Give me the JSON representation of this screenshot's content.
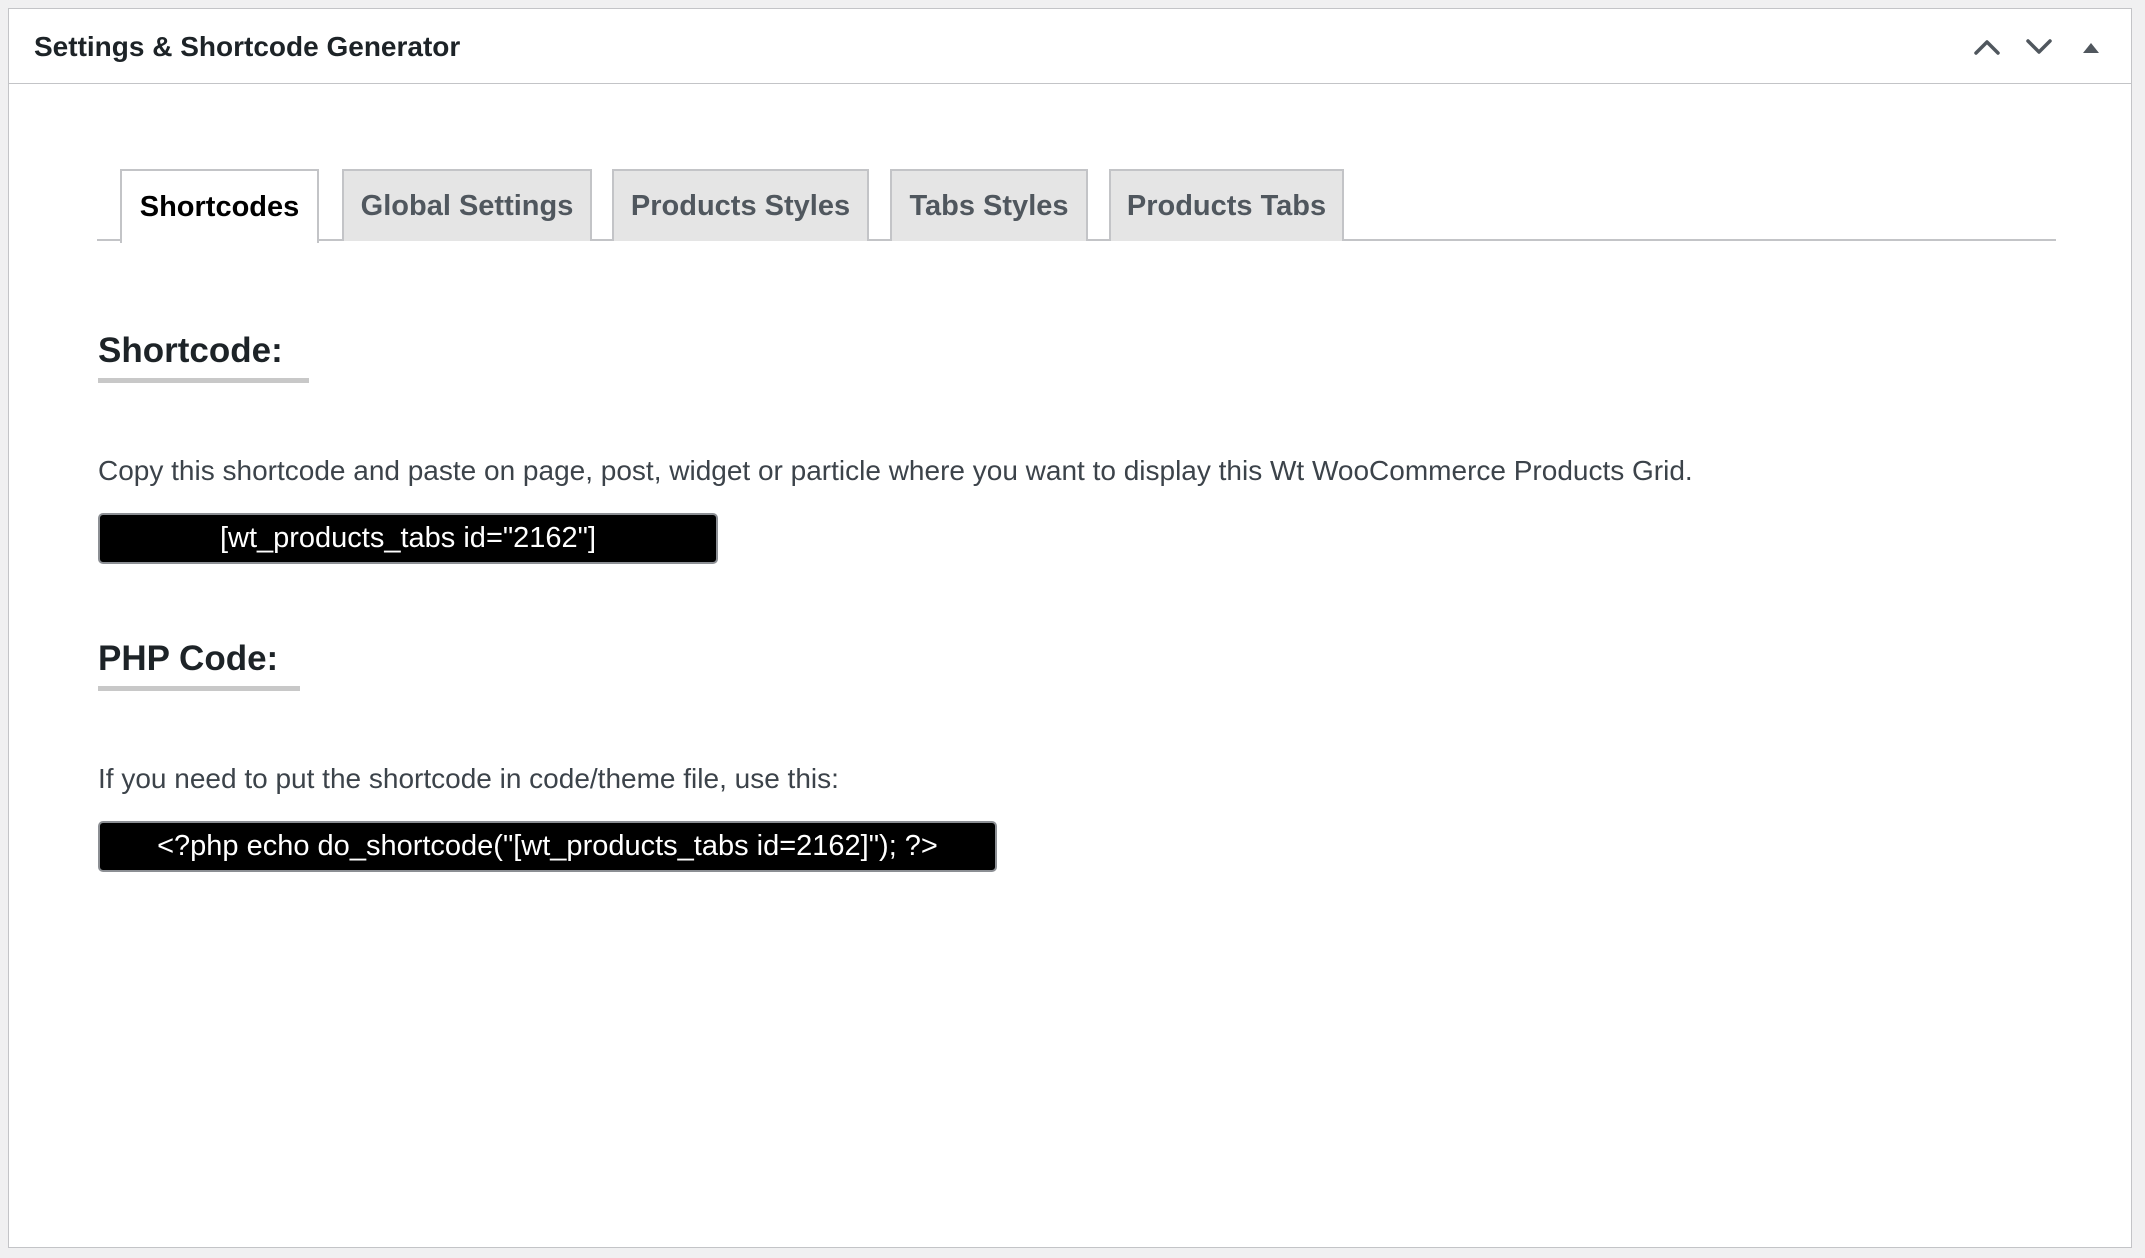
{
  "postbox": {
    "title": "Settings & Shortcode Generator",
    "actions": [
      {
        "name": "move-up",
        "icon": "chevron-up-icon"
      },
      {
        "name": "move-down",
        "icon": "chevron-down-icon"
      },
      {
        "name": "toggle-panel",
        "icon": "triangle-up-icon"
      }
    ]
  },
  "tabs": [
    {
      "label": "Shortcodes",
      "active": true
    },
    {
      "label": "Global Settings",
      "active": false
    },
    {
      "label": "Products Styles",
      "active": false
    },
    {
      "label": "Tabs Styles",
      "active": false
    },
    {
      "label": "Products Tabs",
      "active": false
    }
  ],
  "shortcode_section": {
    "heading": "Shortcode:",
    "description": "Copy this shortcode and paste on page, post, widget or particle where you want to display this Wt WooCommerce Products Grid.",
    "code": "[wt_products_tabs id=\"2162\"]"
  },
  "php_section": {
    "heading": "PHP Code:",
    "description": "If you need to put the shortcode in code/theme file, use this:",
    "code": "<?php echo do_shortcode(\"[wt_products_tabs id=2162]\"); ?>"
  },
  "colors": {
    "code_background": "#000000",
    "code_text": "#ffffff",
    "tab_inactive_bg": "#e5e5e5",
    "border": "#c3c4c7"
  }
}
